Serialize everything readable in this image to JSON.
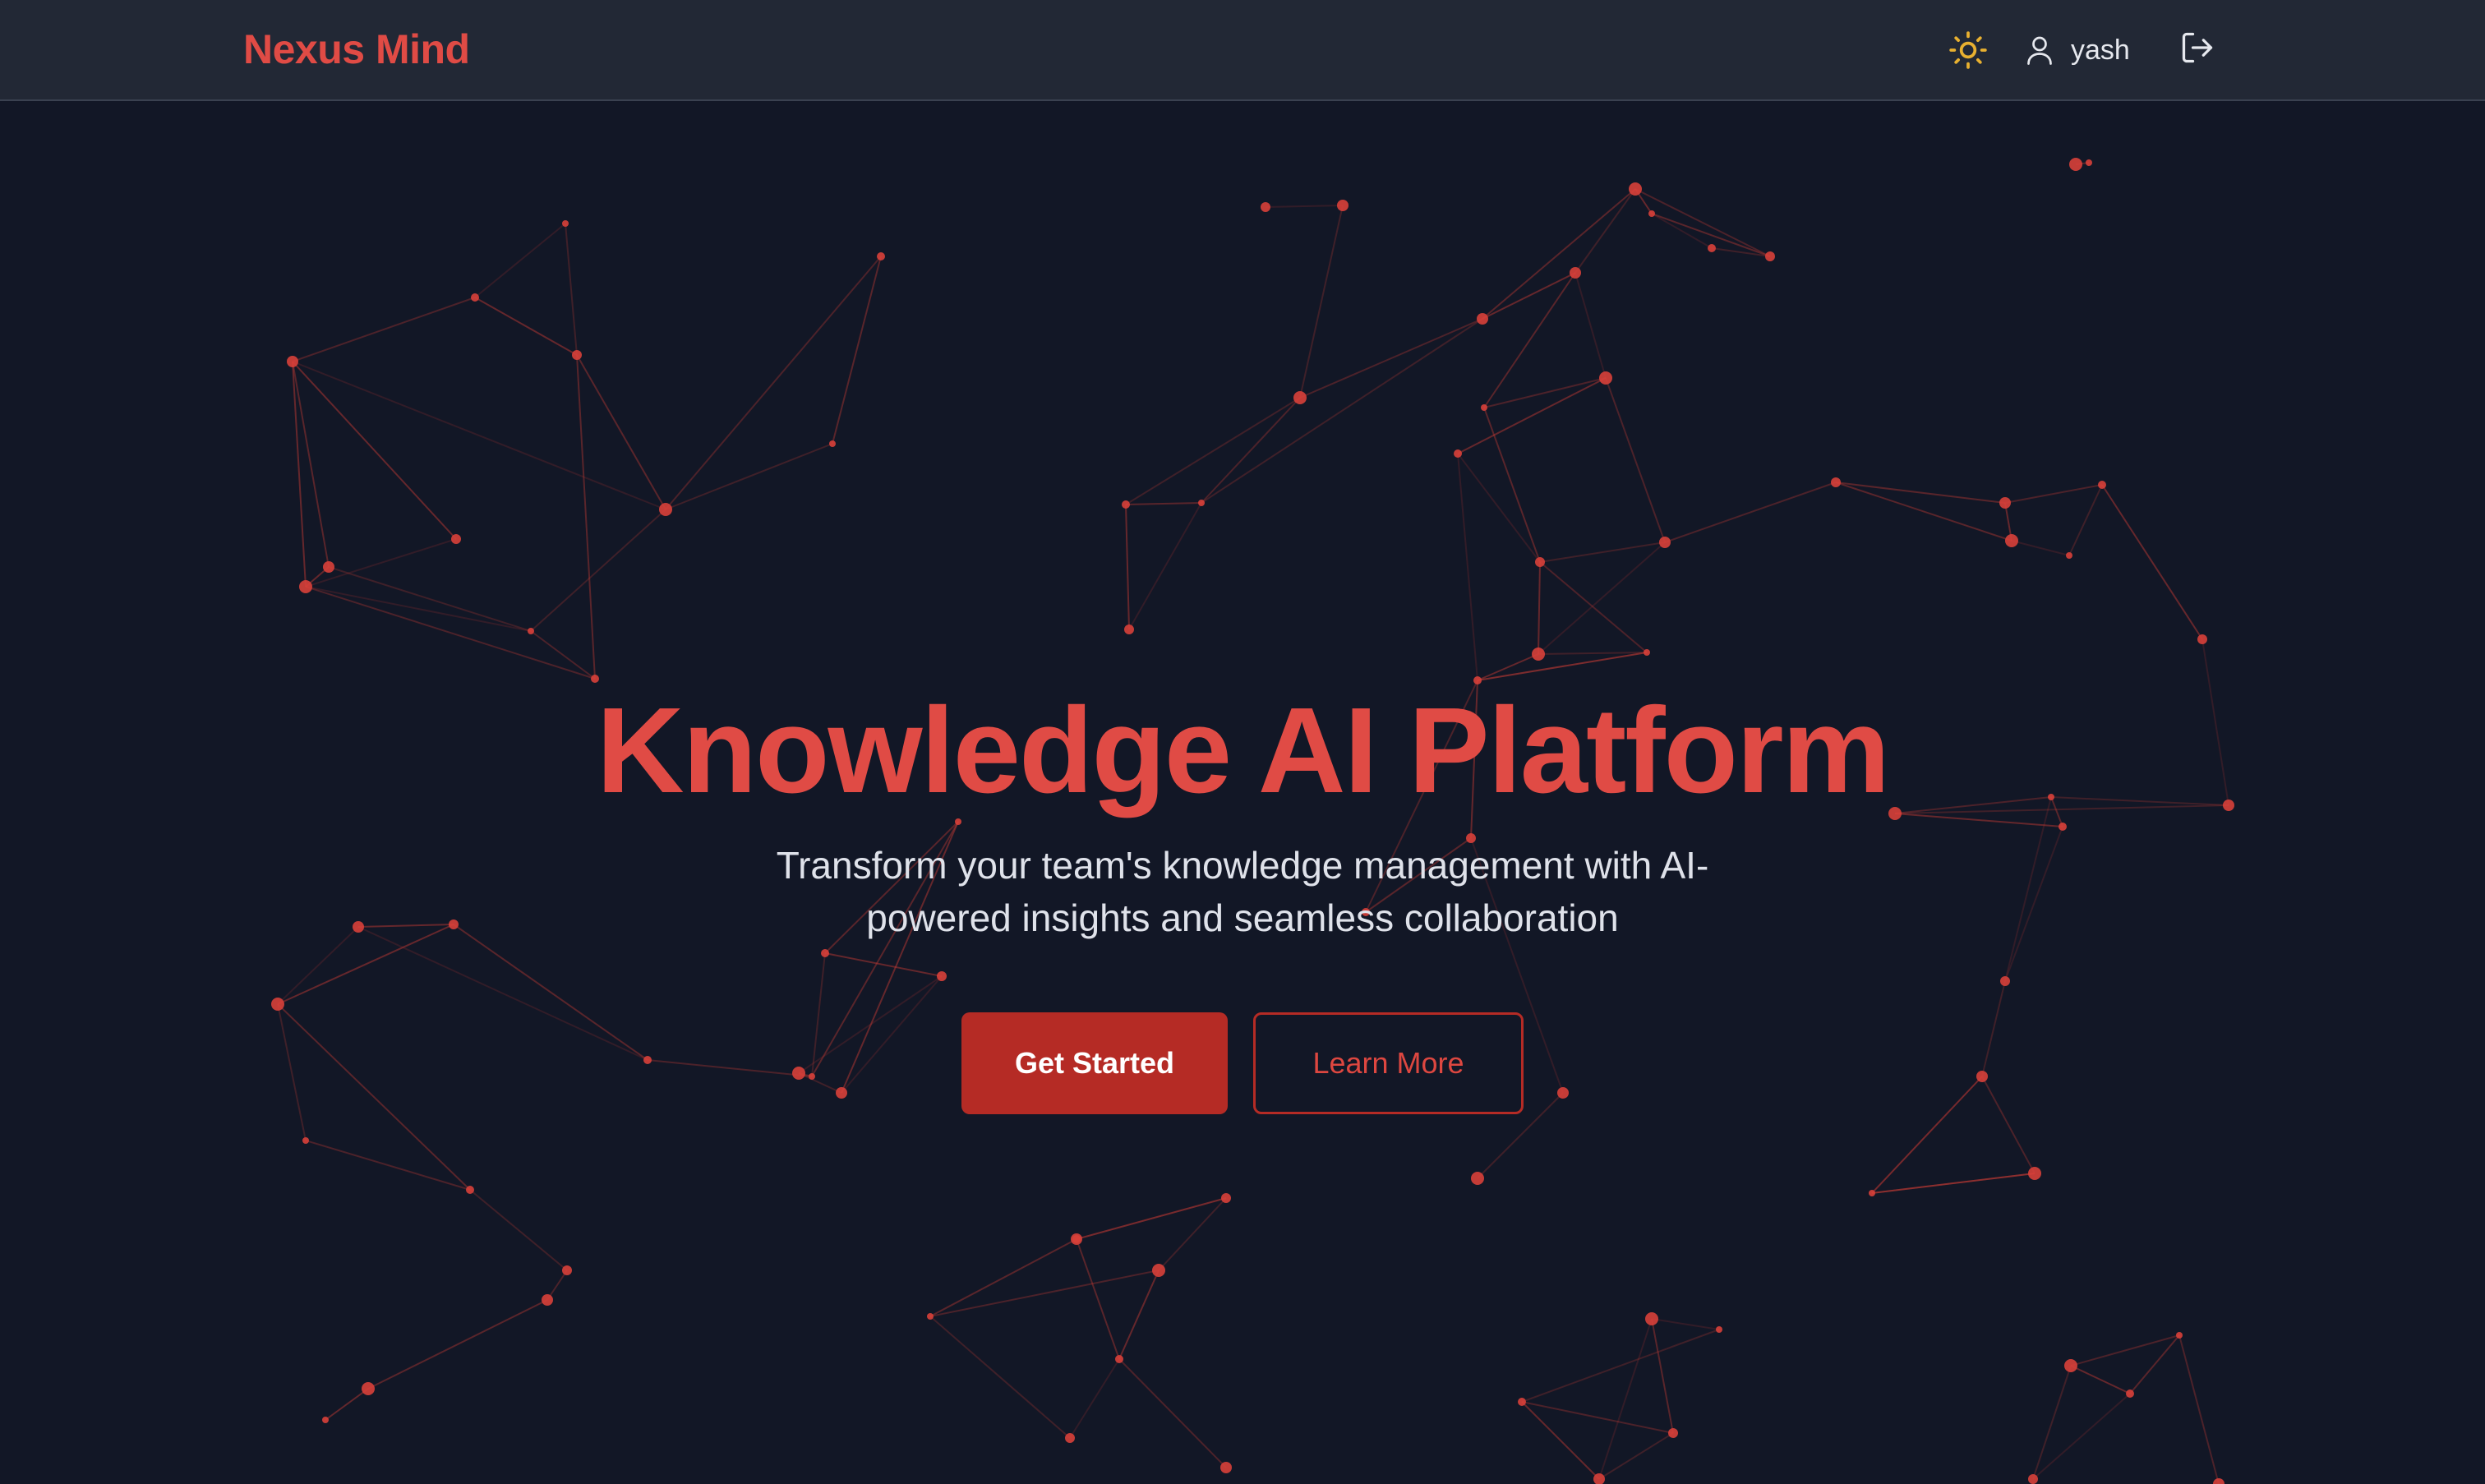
{
  "header": {
    "brand": "Nexus Mind",
    "username": "yash",
    "theme_toggle_icon": "sun-icon",
    "user_icon": "user-icon",
    "logout_icon": "logout-icon"
  },
  "hero": {
    "title": "Knowledge AI Platform",
    "subtitle_line1": "Transform your team's knowledge management with AI-",
    "subtitle_line2": "powered insights and seamless collaboration",
    "primary_button": "Get Started",
    "secondary_button": "Learn More"
  },
  "colors": {
    "background": "#121726",
    "header_bg": "#222835",
    "accent": "#e04b45",
    "primary_button": "#b52b25",
    "network_node": "#d8403a",
    "sun_icon": "#e8b030"
  }
}
